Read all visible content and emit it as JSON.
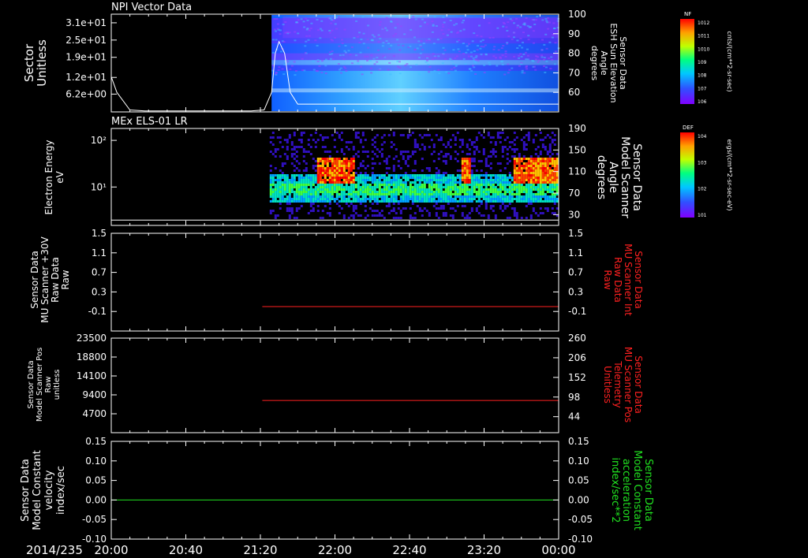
{
  "window": {
    "date_label": "2014/235"
  },
  "x_axis": {
    "start_min": 0,
    "end_min": 240,
    "tick_minutes": [
      0,
      40,
      80,
      120,
      160,
      200,
      240
    ],
    "tick_labels": [
      "20:00",
      "20:40",
      "21:20",
      "22:00",
      "22:40",
      "23:20",
      "00:00"
    ]
  },
  "colors": {
    "frame": "#ffffff",
    "red": "#ff2020",
    "green": "#20e020"
  },
  "chart_data": [
    {
      "type": "spectrogram",
      "title": "NPI Vector Data",
      "left_axis": {
        "label": [
          "Sector",
          "Unitless"
        ],
        "ticks": [
          6.2,
          12,
          19,
          25,
          31
        ],
        "tick_labels": [
          "6.2e+00",
          "1.2e+01",
          "1.9e+01",
          "2.5e+01",
          "3.1e+01"
        ]
      },
      "right_axis": {
        "label": [
          "Sensor Data",
          "ESH Sun Elevation",
          "Angle",
          "degrees"
        ],
        "ticks": [
          60,
          70,
          80,
          90,
          100
        ],
        "range": [
          50,
          100
        ]
      },
      "data_start_min": 86,
      "line": {
        "t": [
          0,
          3,
          10,
          18,
          40,
          60,
          75,
          82,
          86,
          88,
          90,
          93,
          96,
          100,
          240
        ],
        "y": [
          68,
          60,
          51,
          50.5,
          50.5,
          50.5,
          50.5,
          51,
          60,
          80,
          86,
          80,
          60,
          54,
          54
        ]
      },
      "colorbar": {
        "label": "NF",
        "units": "cnts/(cm**2-sr-sec)",
        "ticks": [
          "10^12",
          "10^11",
          "10^10",
          "10^9",
          "10^8",
          "10^7",
          "10^6"
        ]
      }
    },
    {
      "type": "spectrogram",
      "title": "MEx ELS-01 LR",
      "left_axis": {
        "label": [
          "Electron Energy",
          "eV"
        ],
        "ticks": [
          10,
          100
        ],
        "tick_labels": [
          "10¹",
          "10²"
        ],
        "range": [
          1.5,
          180
        ]
      },
      "right_axis": {
        "label": [
          "Sensor Data",
          "Model Scanner",
          "Angle",
          "degrees"
        ],
        "ticks": [
          30,
          70,
          110,
          150,
          190
        ],
        "range": [
          10,
          190
        ]
      },
      "data_start_min": 85,
      "line": {
        "t": [
          0,
          240
        ],
        "y": [
          20,
          20
        ]
      },
      "colorbar": {
        "label": "DEF",
        "units": "ergs/(cm**2-sr-sec-eV)",
        "ticks": [
          "10^4",
          "10^3",
          "10^2",
          "10^1"
        ]
      }
    },
    {
      "type": "line",
      "left_axis": {
        "label": [
          "Sensor Data",
          "MU Scanner +30V",
          "Raw Data",
          "Raw"
        ],
        "ticks": [
          -0.1,
          0.3,
          0.7,
          1.1,
          1.5
        ],
        "tick_labels": [
          "-0.1",
          "0.3",
          "0.7",
          "1.1",
          "1.5"
        ],
        "range": [
          -0.5,
          1.5
        ]
      },
      "right_axis": {
        "label": [
          "Sensor Data",
          "MU Scanner Int",
          "Raw Data",
          "Raw"
        ],
        "ticks": [
          -0.1,
          0.3,
          0.7,
          1.1,
          1.5
        ],
        "tick_labels": [
          "-0.1",
          "0.3",
          "0.7",
          "1.1",
          "1.5"
        ],
        "range": [
          -0.5,
          1.5
        ]
      },
      "series": [
        {
          "t": [
            81,
            240
          ],
          "y": [
            0.0,
            0.0
          ],
          "color": "#ff2020"
        }
      ]
    },
    {
      "type": "line",
      "left_axis": {
        "label": [
          "Sensor Data",
          "Model Scanner Pos",
          "Raw",
          "unitless"
        ],
        "ticks": [
          4700,
          9400,
          14100,
          18800,
          23500
        ],
        "tick_labels": [
          "4700",
          "9400",
          "14100",
          "18800",
          "23500"
        ],
        "range": [
          0,
          23500
        ]
      },
      "right_axis": {
        "label": [
          "Sensor Data",
          "MU Scanner Pos",
          "Telemetry",
          "Unitless"
        ],
        "ticks": [
          44,
          98,
          152,
          206,
          260
        ],
        "tick_labels": [
          "44",
          "98",
          "152",
          "206",
          "260"
        ],
        "range": [
          0,
          260
        ]
      },
      "series": [
        {
          "t": [
            81,
            240
          ],
          "y": [
            8000,
            8000
          ],
          "color": "#ff2020"
        }
      ]
    },
    {
      "type": "line",
      "left_axis": {
        "label": [
          "Sensor Data",
          "Model Constant",
          "velocity",
          "index/sec"
        ],
        "ticks": [
          -0.1,
          -0.05,
          0,
          0.05,
          0.1,
          0.15
        ],
        "tick_labels": [
          "-0.10",
          "-0.05",
          "0.00",
          "0.05",
          "0.10",
          "0.15"
        ],
        "range": [
          -0.1,
          0.15
        ]
      },
      "right_axis": {
        "label": [
          "Sensor Data",
          "Model Constant",
          "acceleration",
          "index/sec**2"
        ],
        "ticks": [
          -0.1,
          -0.05,
          0,
          0.05,
          0.1,
          0.15
        ],
        "tick_labels": [
          "-0.10",
          "-0.05",
          "0.00",
          "0.05",
          "0.10",
          "0.15"
        ],
        "range": [
          -0.1,
          0.15
        ]
      },
      "series": [
        {
          "t": [
            0,
            240
          ],
          "y": [
            0,
            0
          ],
          "color": "#20e020"
        }
      ]
    }
  ]
}
